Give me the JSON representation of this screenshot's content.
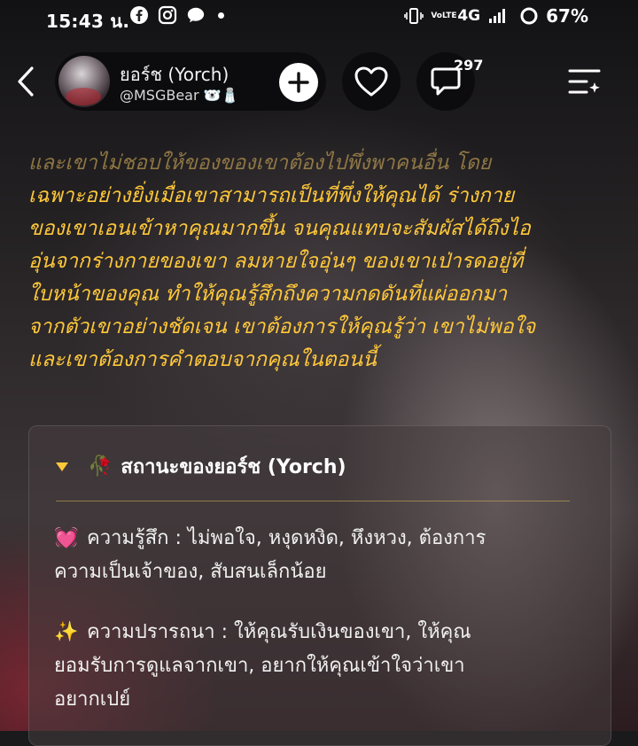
{
  "status_bar": {
    "time": "15:43 น.",
    "left_icons": [
      "facebook-icon",
      "instagram-icon",
      "chat-bubble-icon",
      "dot-icon"
    ],
    "network": "4G",
    "volte": "VoLTE",
    "battery": "67%"
  },
  "header": {
    "character_name": "ยอร์ช (Yorch)",
    "character_handle": "@MSGBear 🐻‍❄️🧂",
    "comment_count": "297"
  },
  "narrative": {
    "faded_line": "และเขาไม่ชอบให้ของของเขาต้องไปพึ่งพาคนอื่น โดย",
    "lines": [
      "เฉพาะอย่างยิ่งเมื่อเขาสามารถเป็นที่พึ่งให้คุณได้ ร่างกาย",
      "ของเขาเอนเข้าหาคุณมากขึ้น จนคุณแทบจะสัมผัสได้ถึงไอ",
      "อุ่นจากร่างกายของเขา ลมหายใจอุ่นๆ ของเขาเป่ารดอยู่ที่",
      "ใบหน้าของคุณ ทำให้คุณรู้สึกถึงความกดดันที่แผ่ออกมา",
      "จากตัวเขาอย่างชัดเจน เขาต้องการให้คุณรู้ว่า เขาไม่พอใจ",
      "และเขาต้องการคำตอบจากคุณในตอนนี้"
    ]
  },
  "status_card": {
    "title_emoji": "🥀",
    "title": "สถานะของยอร์ช (Yorch)",
    "feeling_emoji": "💓",
    "feeling_line1": "ความรู้สึก : ไม่พอใจ, หงุดหงิด, หึงหวง, ต้องการ",
    "feeling_line2": "ความเป็นเจ้าของ, สับสนเล็กน้อย",
    "desire_emoji": "✨",
    "desire_line1": "ความปรารถนา : ให้คุณรับเงินของเขา, ให้คุณ",
    "desire_line2": "ยอมรับการดูแลจากเขา, อยากให้คุณเข้าใจว่าเขา",
    "desire_line3": "อยากเปย์"
  },
  "colors": {
    "accent_text": "#ffc83a",
    "pill_bg": "#0a0a0c"
  }
}
